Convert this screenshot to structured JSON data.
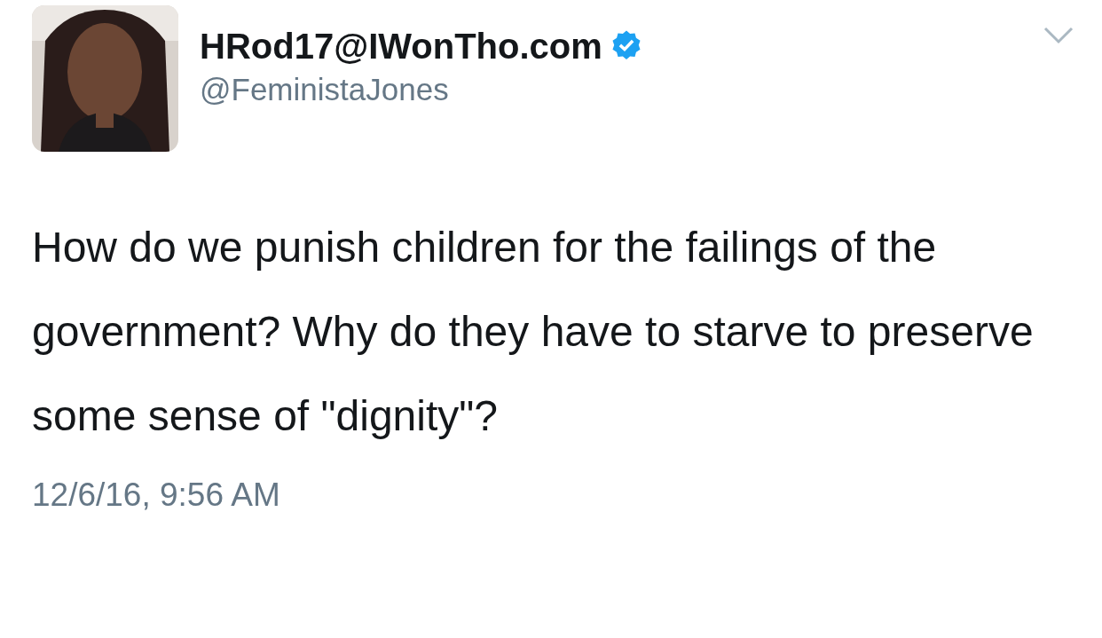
{
  "tweet": {
    "display_name": "HRod17@IWonTho.com",
    "verified": true,
    "handle": "@FeministaJones",
    "text": "How do we punish children for the failings of the government? Why do they have to starve to preserve some sense of \"dignity\"?",
    "timestamp": "12/6/16, 9:56 AM"
  }
}
